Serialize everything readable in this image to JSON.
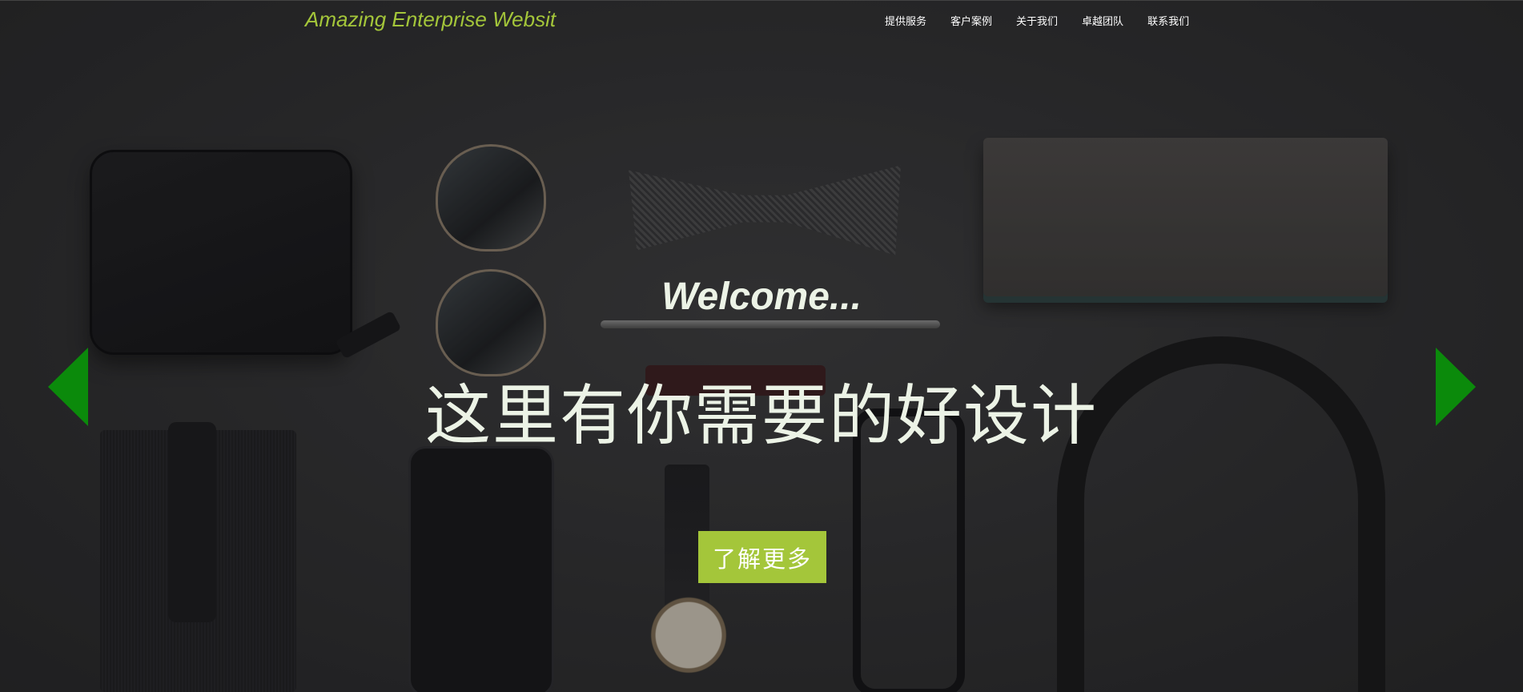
{
  "header": {
    "logo_text": "Amazing Enterprise Websit",
    "nav": [
      {
        "label": "提供服务"
      },
      {
        "label": "客户案例"
      },
      {
        "label": "关于我们"
      },
      {
        "label": "卓越团队"
      },
      {
        "label": "联系我们"
      }
    ]
  },
  "hero": {
    "welcome": "Welcome...",
    "headline": "这里有你需要的好设计",
    "cta_label": "了解更多",
    "prev_icon": "triangle-left-icon",
    "next_icon": "triangle-right-icon"
  },
  "colors": {
    "accent": "#a4c63a",
    "arrow": "#0b8a0b",
    "hero_text": "#ecf3e6"
  }
}
